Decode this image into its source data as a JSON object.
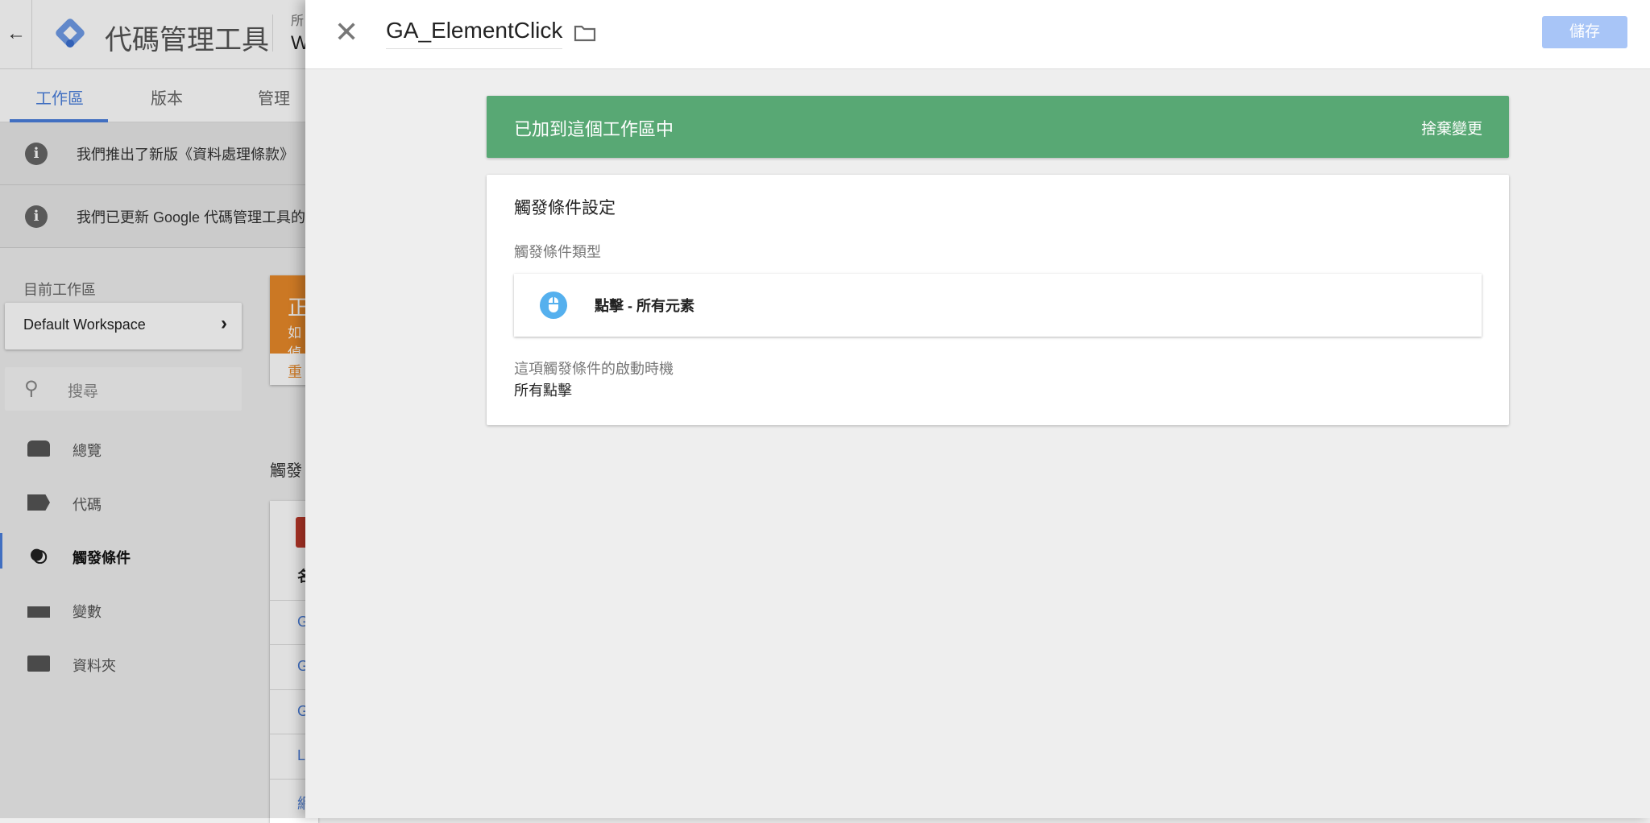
{
  "app": {
    "back_icon": "arrow-left-icon",
    "name": "代碼管理工具",
    "account_label": "所",
    "container_initial": "W"
  },
  "tabs": [
    {
      "label": "工作區",
      "active": true
    },
    {
      "label": "版本"
    },
    {
      "label": "管理"
    }
  ],
  "notices": [
    "我們推出了新版《資料處理條款》",
    "我們已更新 Google 代碼管理工具的"
  ],
  "sidebar": {
    "workspace_label": "目前工作區",
    "workspace": "Default Workspace",
    "search_placeholder": "搜尋",
    "items": [
      {
        "label": "總覽",
        "icon": "overview-icon"
      },
      {
        "label": "代碼",
        "icon": "tag-icon"
      },
      {
        "label": "觸發條件",
        "icon": "trigger-icon",
        "active": true
      },
      {
        "label": "變數",
        "icon": "variable-icon"
      },
      {
        "label": "資料夾",
        "icon": "folder-icon"
      }
    ]
  },
  "background": {
    "orange_title": "正",
    "orange_lines": [
      "如",
      "偵"
    ],
    "orange_link": "重",
    "section_title": "觸發",
    "table_header": "名",
    "rows": [
      "G",
      "G",
      "G",
      "L",
      "網"
    ]
  },
  "panel": {
    "title": "GA_ElementClick",
    "save_label": "儲存",
    "banner": {
      "text": "已加到這個工作區中",
      "action": "捨棄變更",
      "color": "#58a874"
    },
    "card": {
      "title": "觸發條件設定",
      "type_label": "觸發條件類型",
      "type_value": "點擊 - 所有元素",
      "fire_label": "這項觸發條件的啟動時機",
      "fire_value": "所有點擊"
    }
  }
}
